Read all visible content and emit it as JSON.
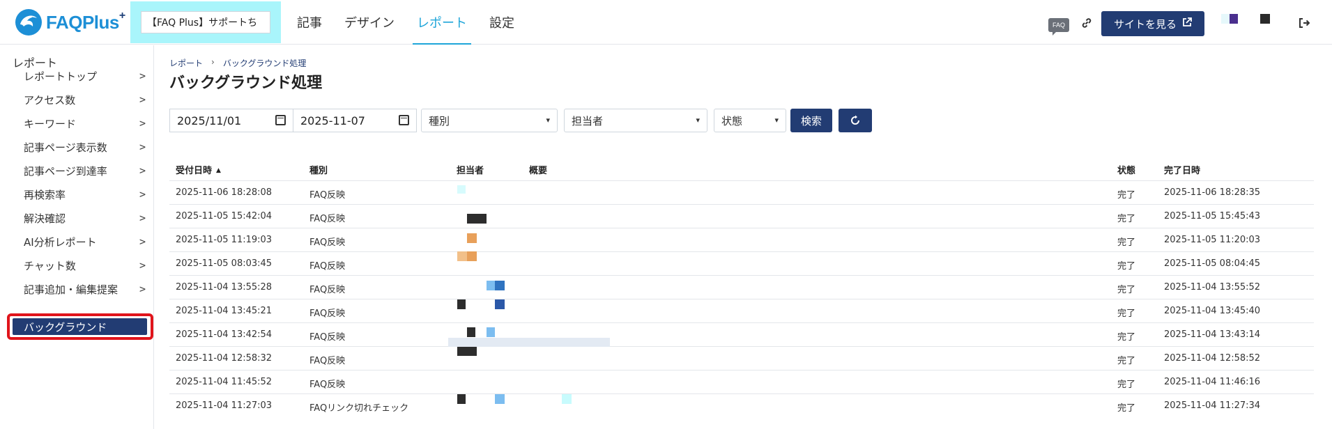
{
  "header": {
    "logo_text": "FAQPlus",
    "logo_plus": "+",
    "site_select_value": "【FAQ Plus】サポートち",
    "nav": [
      {
        "label": "記事",
        "active": false
      },
      {
        "label": "デザイン",
        "active": false
      },
      {
        "label": "レポート",
        "active": true
      },
      {
        "label": "設定",
        "active": false
      }
    ],
    "faq_badge": "FAQ",
    "link_icon": "link-icon",
    "view_site_label": "サイトを見る",
    "external_icon": "external-link-icon",
    "logout_icon": "logout-icon"
  },
  "sidebar": {
    "title": "レポート",
    "items": [
      {
        "label": "レポートトップ",
        "chevron": ">"
      },
      {
        "label": "アクセス数",
        "chevron": ">"
      },
      {
        "label": "キーワード",
        "chevron": ">"
      },
      {
        "label": "記事ページ表示数",
        "chevron": ">"
      },
      {
        "label": "記事ページ到達率",
        "chevron": ">"
      },
      {
        "label": "再検索率",
        "chevron": ">"
      },
      {
        "label": "解決確認",
        "chevron": ">"
      },
      {
        "label": "AI分析レポート",
        "chevron": ">"
      },
      {
        "label": "チャット数",
        "chevron": ">"
      },
      {
        "label": "記事追加・編集提案",
        "chevron": ">"
      }
    ],
    "active_item": "バックグラウンド"
  },
  "main": {
    "breadcrumb": [
      "レポート",
      "バックグラウンド処理"
    ],
    "breadcrumb_sep": "›",
    "title": "バックグラウンド処理",
    "filters": {
      "date_from": "2025/11/01",
      "date_to": "2025-11-07",
      "type_placeholder": "種別",
      "owner_placeholder": "担当者",
      "status_placeholder": "状態",
      "search_label": "検索",
      "reset_icon": "refresh-icon"
    },
    "table": {
      "columns": [
        "受付日時",
        "種別",
        "担当者",
        "概要",
        "状態",
        "完了日時"
      ],
      "sort_indicator": "▲",
      "rows": [
        {
          "received": "2025-11-06 18:28:08",
          "type": "FAQ反映",
          "status": "完了",
          "completed": "2025-11-06 18:28:35"
        },
        {
          "received": "2025-11-05 15:42:04",
          "type": "FAQ反映",
          "status": "完了",
          "completed": "2025-11-05 15:45:43"
        },
        {
          "received": "2025-11-05 11:19:03",
          "type": "FAQ反映",
          "status": "完了",
          "completed": "2025-11-05 11:20:03"
        },
        {
          "received": "2025-11-05 08:03:45",
          "type": "FAQ反映",
          "status": "完了",
          "completed": "2025-11-05 08:04:45"
        },
        {
          "received": "2025-11-04 13:55:28",
          "type": "FAQ反映",
          "status": "完了",
          "completed": "2025-11-04 13:55:52"
        },
        {
          "received": "2025-11-04 13:45:21",
          "type": "FAQ反映",
          "status": "完了",
          "completed": "2025-11-04 13:45:40"
        },
        {
          "received": "2025-11-04 13:42:54",
          "type": "FAQ反映",
          "status": "完了",
          "completed": "2025-11-04 13:43:14"
        },
        {
          "received": "2025-11-04 12:58:32",
          "type": "FAQ反映",
          "status": "完了",
          "completed": "2025-11-04 12:58:52"
        },
        {
          "received": "2025-11-04 11:45:52",
          "type": "FAQ反映",
          "status": "完了",
          "completed": "2025-11-04 11:46:16"
        },
        {
          "received": "2025-11-04 11:27:03",
          "type": "FAQリンク切れチェック",
          "status": "完了",
          "completed": "2025-11-04 11:27:34"
        }
      ]
    }
  },
  "colors": {
    "brand_navy": "#223c73",
    "accent_cyan": "#1ea5d9",
    "highlight_outline": "#e0141b",
    "site_select_bg": "#a9f5fb"
  }
}
